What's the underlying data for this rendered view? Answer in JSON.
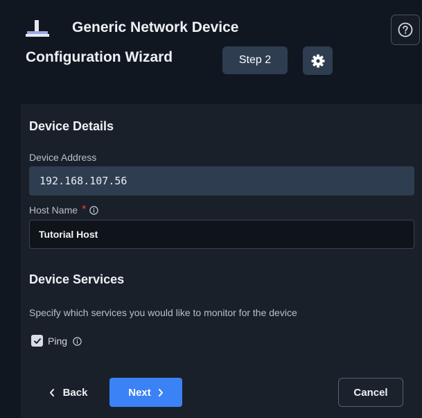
{
  "header": {
    "title_line1": "Generic Network Device",
    "title_line2": "Configuration Wizard",
    "step_label": "Step 2",
    "icons": {
      "device": "network-device-icon",
      "help": "help-circle-icon",
      "settings": "gear-icon"
    }
  },
  "device_details": {
    "heading": "Device Details",
    "address_label": "Device Address",
    "address_value": "192.168.107.56",
    "host_label": "Host Name",
    "host_required_mark": "*",
    "host_value": "Tutorial Host"
  },
  "device_services": {
    "heading": "Device Services",
    "description": "Specify which services you would like to monitor for the device",
    "services": [
      {
        "label": "Ping",
        "checked": true
      }
    ]
  },
  "footer": {
    "back_label": "Back",
    "next_label": "Next",
    "cancel_label": "Cancel"
  },
  "colors": {
    "background": "#111720",
    "panel": "#1a2029",
    "accent": "#3b82f6",
    "badge": "#2f3d50",
    "required": "#ff3b30"
  }
}
